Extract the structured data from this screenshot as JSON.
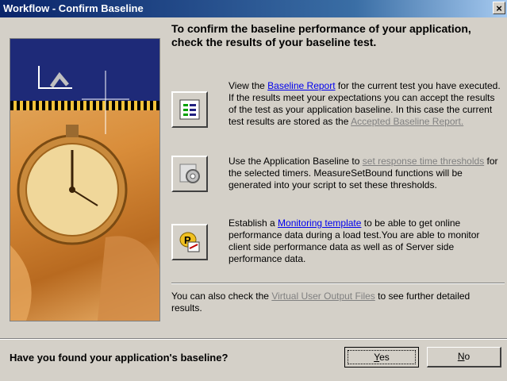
{
  "window": {
    "title": "Workflow - Confirm Baseline",
    "close_label": "×"
  },
  "heading": "To confirm the baseline performance of your application, check the results of your baseline test.",
  "section1": {
    "pre": "View the ",
    "link": "Baseline Report",
    "mid": " for the current test you have executed. If the results meet your expectations you can accept the results of the test as your application baseline. In this case the current test results are stored as the ",
    "link2": "Accepted Baseline Report.",
    "icon": "report-icon"
  },
  "section2": {
    "pre": "Use the Application Baseline to ",
    "link": "set response time thresholds",
    "post": " for the selected timers. MeasureSetBound functions will be generated into your script to set these thresholds.",
    "icon": "threshold-gear-icon"
  },
  "section3": {
    "pre": "Establish a ",
    "link": "Monitoring template",
    "post": " to be able to get online performance data during a load test.You are able to monitor client side performance data as well as of Server side performance data.",
    "icon": "monitoring-template-icon"
  },
  "footer_note": {
    "pre": "You can also check the ",
    "link": "Virtual User Output Files",
    "post": " to see further detailed results."
  },
  "question": "Have you found your application's baseline?",
  "buttons": {
    "yes_mnemonic": "Y",
    "yes_rest": "es",
    "no_mnemonic": "N",
    "no_rest": "o"
  }
}
